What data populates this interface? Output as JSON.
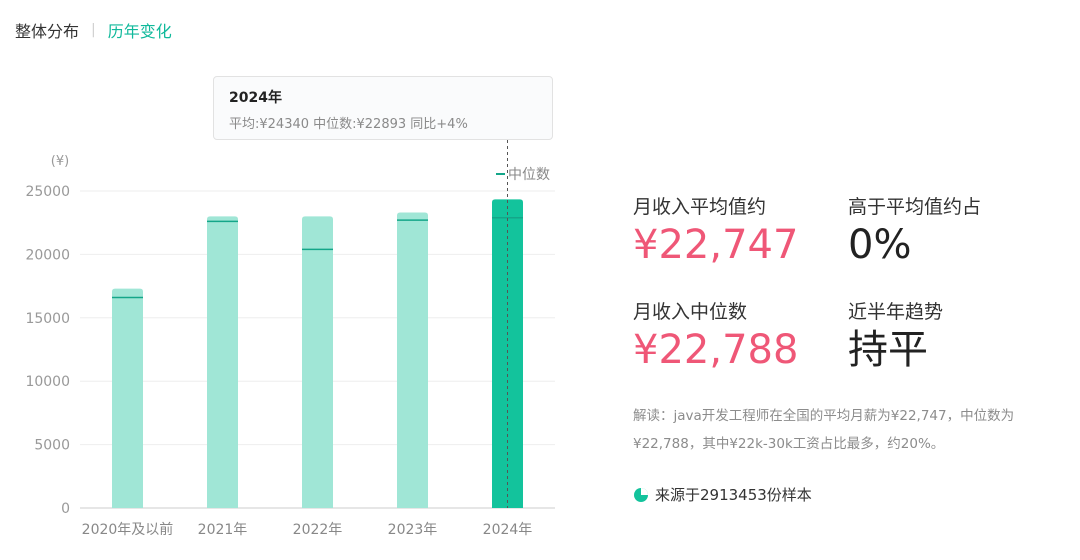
{
  "tabs": {
    "overall": "整体分布",
    "history": "历年变化"
  },
  "tooltip": {
    "title": "2024年",
    "body": "平均:¥24340  中位数:¥22893  同比+4%"
  },
  "chart_data": {
    "type": "bar",
    "unit_label": "(¥)",
    "categories": [
      "2020年及以前",
      "2021年",
      "2022年",
      "2023年",
      "2024年"
    ],
    "series": [
      {
        "values": [
          17300,
          23000,
          23000,
          23300,
          24340
        ]
      },
      {
        "name": "中位数",
        "type": "marker",
        "values": [
          16600,
          22600,
          20400,
          22700,
          22893
        ]
      }
    ],
    "ylim": [
      0,
      25000
    ],
    "yticks": [
      0,
      5000,
      10000,
      15000,
      20000,
      25000
    ],
    "highlight_index": 4,
    "colors": {
      "bar": "#a0e6d6",
      "bar_highlight": "#13c39c",
      "marker": "#14a689",
      "grid": "#eeeeee",
      "axis_text": "#999999"
    },
    "legend_position": "top-right"
  },
  "stats": {
    "avg_label": "月收入平均值约",
    "avg_value": "¥22,747",
    "above_label": "高于平均值约占",
    "above_value": "0%",
    "median_label": "月收入中位数",
    "median_value": "¥22,788",
    "trend_label": "近半年趋势",
    "trend_value": "持平"
  },
  "description": "解读：java开发工程师在全国的平均月薪为¥22,747，中位数为¥22,788，其中¥22k-30k工资占比最多，约20%。",
  "source": "来源于2913453份样本"
}
